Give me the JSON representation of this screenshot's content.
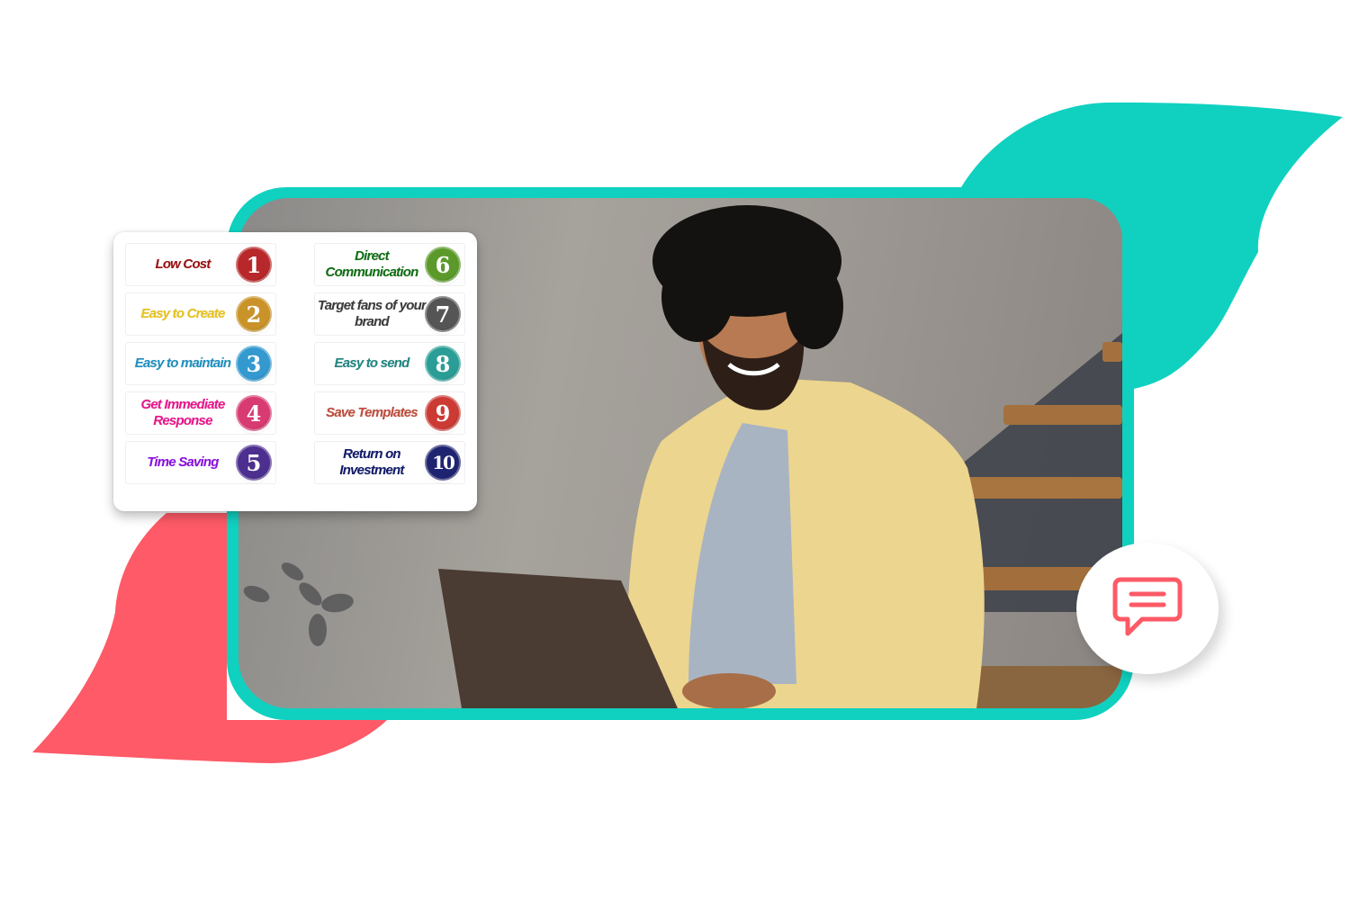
{
  "colors": {
    "teal_accent": "#10d1c0",
    "coral_accent": "#fe5a67",
    "chat_icon": "#fd5a66",
    "card_background": "#ffffff"
  },
  "photo": {
    "description": "Smiling man with curly hair in yellow shirt working on a laptop"
  },
  "benefits": {
    "items": [
      {
        "number": "1",
        "label": "Low Cost",
        "text_color": "#9a0f0f",
        "badge_color": "#b8282a"
      },
      {
        "number": "2",
        "label": "Easy to Create",
        "text_color": "#e8c21a",
        "badge_color": "#c9932a"
      },
      {
        "number": "3",
        "label": "Easy to maintain",
        "text_color": "#1e8fc0",
        "badge_color": "#3399cf"
      },
      {
        "number": "4",
        "label": "Get Immediate Response",
        "text_color": "#e8158a",
        "badge_color": "#d83a72"
      },
      {
        "number": "5",
        "label": "Time Saving",
        "text_color": "#8a10e0",
        "badge_color": "#4c2f8f"
      },
      {
        "number": "6",
        "label": "Direct Communication",
        "text_color": "#0f6e12",
        "badge_color": "#5b9a2a"
      },
      {
        "number": "7",
        "label": "Target fans of your brand",
        "text_color": "#3a3a3a",
        "badge_color": "#555555"
      },
      {
        "number": "8",
        "label": "Easy to send",
        "text_color": "#1f8480",
        "badge_color": "#2a9e96"
      },
      {
        "number": "9",
        "label": "Save Templates",
        "text_color": "#c04a3a",
        "badge_color": "#cc3a34"
      },
      {
        "number": "10",
        "label": "Return on Investment",
        "text_color": "#101a6a",
        "badge_color": "#1f2470"
      }
    ]
  },
  "chat_button": {
    "icon": "chat-bubble-icon"
  }
}
